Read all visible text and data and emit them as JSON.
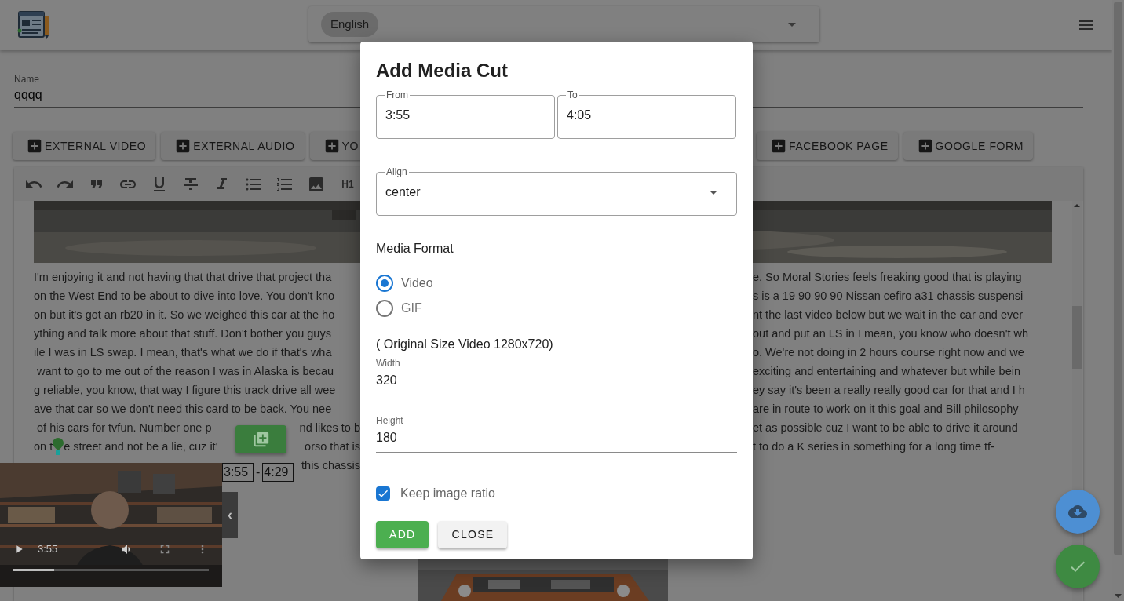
{
  "header": {
    "language": "English"
  },
  "name_field": {
    "label": "Name",
    "value": "qqqq"
  },
  "insert_buttons": [
    "EXTERNAL VIDEO",
    "EXTERNAL AUDIO",
    "YO",
    "FACEBOOK PAGE",
    "GOOGLE FORM"
  ],
  "toolbar": {
    "heading_button": "H1"
  },
  "editor_lines": [
    {
      "left": "I'm enjoying it and not having that that drive that project tha",
      "right": "e. So Moral Stories feels freaking good that is playing"
    },
    {
      "left": "on the West End to be about to dive into love. You don't kno",
      "right": "s is a 19 90 90 90 Nissan cefiro a31 chassis suspensi"
    },
    {
      "left": "on but it's got an rb20 in it. So we weighed this car at the ho",
      "right": "nt the last video below but we wait in the car and ever"
    },
    {
      "left": "ything and talk more about that stuff. Don't bother you guys",
      "right": "out and put an LS in I mean, you know who doesn't wh"
    },
    {
      "left": "ile I was in LS swap. I mean, that's what we do if that's wha",
      "right": "o. We're not doing in 2 hours course right now and we"
    },
    {
      "left": " want to go to me out of the reason I was in Alaska is becau",
      "right": "exciting and entertaining and whatever but while bein"
    },
    {
      "left": "g reliable, you know, that way I figure this track drive all wee",
      "right": "ey say it's been a really really good car for that and I h"
    },
    {
      "left": "ave that car so we don't need this card to be back. You nee",
      "right": "are in route to work on it this goal and Bill philosophy"
    },
    {
      "left": " of his cars for tvfun. Number one p",
      "tail": "nd likes to b",
      "right": "et as possible cuz I want to be able to drive it around"
    },
    {
      "left": "on t",
      "after_pin": "e street and not be a lie, cuz it'",
      "tail": "orso that is",
      "right": "t to do a K series in something for a long time tf-"
    },
    {
      "tail": "this chassis"
    }
  ],
  "video_player": {
    "time": "3:55",
    "level": 0.21,
    "collapse_tab": "‹"
  },
  "cut_range": {
    "start": "3:55",
    "separator": "-",
    "end": "4:29"
  },
  "dialog": {
    "title": "Add Media Cut",
    "from": {
      "label": "From",
      "value": "3:55"
    },
    "to": {
      "label": "To",
      "value": "4:05"
    },
    "align": {
      "label": "Align",
      "value": "center"
    },
    "format_heading": "Media Format",
    "formats": [
      {
        "label": "Video",
        "selected": true
      },
      {
        "label": "GIF",
        "selected": false
      }
    ],
    "original_size": "( Original Size Video 1280x720)",
    "width": {
      "label": "Width",
      "value": "320"
    },
    "height": {
      "label": "Height",
      "value": "180"
    },
    "keep_ratio": {
      "label": "Keep image ratio",
      "checked": true
    },
    "buttons": [
      {
        "label": "ADD",
        "kind": "primary"
      },
      {
        "label": "CLOSE",
        "kind": "secondary"
      }
    ]
  }
}
